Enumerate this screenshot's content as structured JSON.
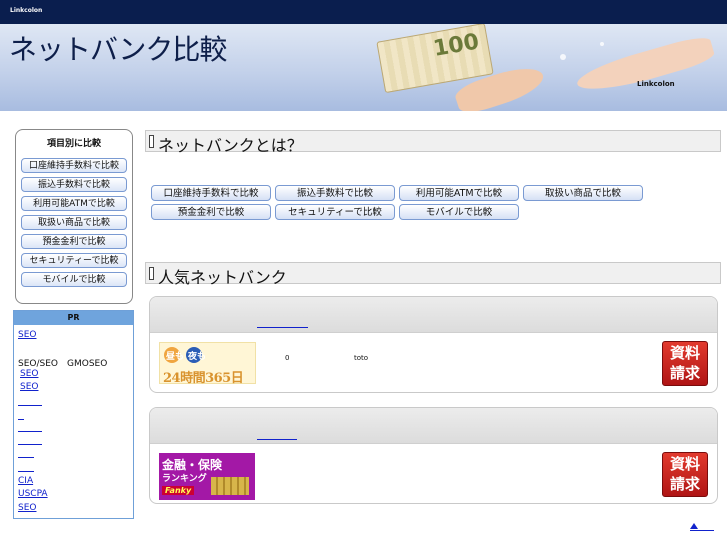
{
  "header": {
    "top_label": "Linkcolon",
    "title": "ネットバンク比較",
    "brand": "Linkcolon",
    "note_value": "100"
  },
  "left_menu": {
    "title": "項目別に比較",
    "items": [
      "口座維持手数料で比較",
      "振込手数料で比較",
      "利用可能ATMで比較",
      "取扱い商品で比較",
      "預金金利で比較",
      "セキュリティーで比較",
      "モバイルで比較"
    ]
  },
  "pr": {
    "title": "PR",
    "lines": [
      "SEO",
      "SEO/SEO　GMOSEO",
      "SEO",
      "SEO",
      "CIA",
      "USCPA",
      "SEO"
    ]
  },
  "section1": {
    "title": "ネットバンクとは？",
    "buttons_row1": [
      "口座維持手数料で比較",
      "振込手数料で比較",
      "利用可能ATMで比較",
      "取扱い商品で比較"
    ],
    "buttons_row2": [
      "預金金利で比較",
      "セキュリティーで比較",
      "モバイルで比較"
    ]
  },
  "section2": {
    "title": "人気ネットバンク",
    "cards": [
      {
        "logo_top_left": "昼も",
        "logo_top_right": "夜も",
        "logo_bottom": "24時間365日",
        "value_a": "0",
        "value_b": "toto",
        "request_label": "資料請求"
      },
      {
        "logo_line1": "金融・保険",
        "logo_line2": "ランキング",
        "logo_brand": "Fanky",
        "request_label": "資料請求"
      }
    ]
  },
  "colors": {
    "topbar": "#0a1e4e",
    "link": "#1122cc",
    "request": "#c8201a",
    "pr_head": "#6fa4dd"
  }
}
